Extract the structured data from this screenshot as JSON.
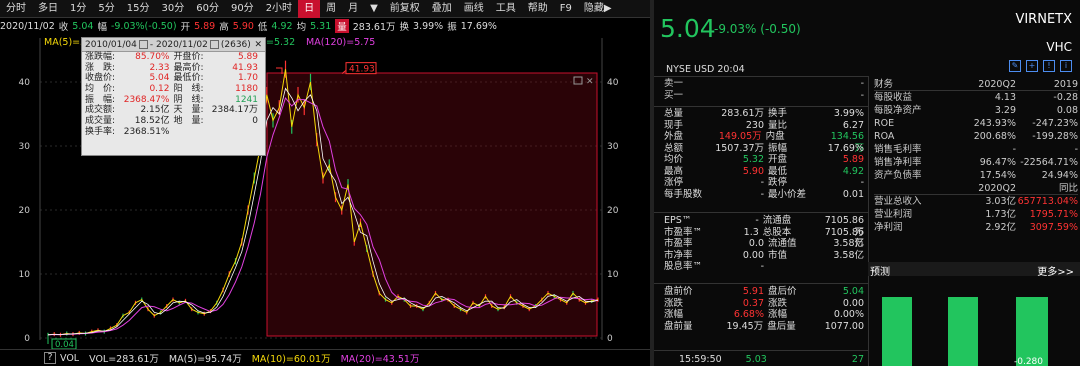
{
  "toolbar": {
    "items": [
      "分时",
      "多日",
      "1分",
      "5分",
      "15分",
      "30分",
      "60分",
      "90分",
      "2小时",
      "日",
      "周",
      "月",
      "▼",
      "前复权",
      "叠加",
      "画线",
      "工具",
      "帮助",
      "F9",
      "隐藏▶"
    ]
  },
  "quote": {
    "date": "2020/11/02",
    "close_label": "收",
    "close": "5.04",
    "chg_label": "幅",
    "chg": "-9.03%(-0.50)",
    "open_label": "开",
    "open": "5.89",
    "high_label": "高",
    "high": "5.90",
    "low_label": "低",
    "low": "4.92",
    "settle_label": "均",
    "settle": "5.31",
    "vol_label": "量",
    "vol": "283.61万",
    "turn_label": "换",
    "turn": "3.99%",
    "amp_label": "振",
    "amp": "17.69%"
  },
  "ma": {
    "ma5": "MA(5)=5",
    "ma120": "MA(120)=5.75",
    "ma60": "=5.32"
  },
  "tooltip": {
    "header": "2010/01/04",
    "header2": "- 2020/11/02",
    "count": "(2636)",
    "rows": [
      [
        "涨跌幅:",
        "85.70%",
        "开盘价:",
        "5.89"
      ],
      [
        "涨　跌:",
        "2.33",
        "最高价:",
        "41.93"
      ],
      [
        "收盘价:",
        "5.04",
        "最低价:",
        "1.70"
      ],
      [
        "均　价:",
        "0.12",
        "阳　线:",
        "1180"
      ],
      [
        "振　幅:",
        "2368.47%",
        "阴　线:",
        "1241"
      ],
      [
        "成交额:",
        "2.15亿",
        "天　量:",
        "2384.17万"
      ],
      [
        "成交量:",
        "18.52亿",
        "地　量:",
        "0"
      ],
      [
        "换手率:",
        "2368.51%",
        "",
        ""
      ]
    ]
  },
  "chart_data": {
    "type": "line",
    "title": "",
    "y_ticks": [
      0,
      10,
      20,
      30,
      40
    ],
    "ylim": [
      0,
      45
    ],
    "annotations": {
      "max": "41.93",
      "min": "0.04"
    },
    "series": [
      {
        "values": [
          0.5,
          0.6,
          0.5,
          0.7,
          0.6,
          0.8,
          0.7,
          1.0,
          1.2,
          1.0,
          1.5,
          2.0,
          3.5,
          4.0,
          5.5,
          6.0,
          4.5,
          3.5,
          4.0,
          5.0,
          6.0,
          5.5,
          5.8,
          4.5,
          4.0,
          3.8,
          4.2,
          5.5,
          7.5,
          10.0,
          12.0,
          15.0,
          20.0,
          25.0,
          30.0,
          38.0,
          34.0,
          36.0,
          42.0,
          33.0,
          38.0,
          36.0,
          40.0,
          31.0,
          25.0,
          27.0,
          22.0,
          20.0,
          24.0,
          15.0,
          18.0,
          14.0,
          10.0,
          7.0,
          6.0,
          5.5,
          6.5,
          6.0,
          5.0,
          5.0,
          4.5,
          5.5,
          7.0,
          6.0,
          6.0,
          5.0,
          4.5,
          4.0,
          5.5,
          5.0,
          6.5,
          5.0,
          4.5,
          4.8,
          6.5,
          5.5,
          5.0,
          4.5,
          5.0,
          6.0,
          7.0,
          6.5,
          6.0,
          5.5,
          7.0,
          6.0,
          5.5,
          5.8,
          6.0
        ]
      }
    ]
  },
  "vol": {
    "label": "VOL",
    "vol": "VOL=283.61万",
    "ma5": "MA(5)=95.74万",
    "ma10": "MA(10)=60.01万",
    "ma20": "MA(20)=43.51万"
  },
  "right": {
    "price": "5.04",
    "change": "-9.03%",
    "change2": "(-0.50)",
    "ticker": "VIRNETX",
    "sub": "VHC",
    "exchange": "NYSE",
    "currency": "USD",
    "time": "20:04",
    "sell1": "卖一",
    "buy1": "买一",
    "dash": "-",
    "left_rows": [
      [
        "总量",
        "283.61万",
        "换手",
        "3.99%"
      ],
      [
        "现手",
        "230",
        "量比",
        "6.27"
      ],
      [
        "外盘",
        "149.05万",
        "内盘",
        "134.56万"
      ],
      [
        "总额",
        "1507.37万",
        "振幅",
        "17.69%"
      ],
      [
        "均价",
        "5.32",
        "开盘",
        "5.89"
      ],
      [
        "最高",
        "5.90",
        "最低",
        "4.92"
      ],
      [
        "涨停",
        "-",
        "跌停",
        "-"
      ],
      [
        "每手股数",
        "-",
        "最小价差",
        "0.01"
      ]
    ],
    "left_rows2": [
      [
        "EPS™",
        "-",
        "流通盘",
        "7105.86万"
      ],
      [
        "市盈率™",
        "1.3",
        "总股本",
        "7105.86万"
      ],
      [
        "市盈率",
        "0.0",
        "流通值",
        "3.58亿"
      ],
      [
        "市净率",
        "0.00",
        "市值",
        "3.58亿"
      ],
      [
        "股息率™",
        "-",
        "",
        ""
      ]
    ],
    "left_rows3": [
      [
        "盘前价",
        "5.91",
        "盘后价",
        "5.04"
      ],
      [
        "涨跌",
        "0.37",
        "涨跌",
        "0.00"
      ],
      [
        "涨幅",
        "6.68%",
        "涨幅",
        "0.00%"
      ],
      [
        "盘前量",
        "19.45万",
        "盘后量",
        "1077.00"
      ]
    ],
    "tick": [
      "15:59:50",
      "5.03",
      "27"
    ],
    "fin_head": [
      "财务",
      "2020Q2",
      "2019"
    ],
    "fin_rows": [
      [
        "每股收益",
        "4.13",
        "-0.28"
      ],
      [
        "每股净资产",
        "3.29",
        "0.08"
      ],
      [
        "ROE",
        "243.93%",
        "-247.23%"
      ],
      [
        "ROA",
        "200.68%",
        "-199.28%"
      ],
      [
        "销售毛利率",
        "-",
        "-"
      ],
      [
        "销售净利率",
        "96.47%",
        "-22564.71%"
      ],
      [
        "资产负债率",
        "17.54%",
        "24.94%"
      ]
    ],
    "fin_head2": [
      "",
      "2020Q2",
      "同比"
    ],
    "fin_rows2": [
      [
        "营业总收入",
        "3.03亿",
        "657713.04%"
      ],
      [
        "营业利润",
        "1.73亿",
        "1795.71%"
      ],
      [
        "净利润",
        "2.92亿",
        "3097.59%"
      ]
    ],
    "forecast": "预测",
    "more": "更多>>",
    "bars": [
      "-0.280"
    ]
  },
  "colors": {
    "up": "#ff3333",
    "down": "#22c55e",
    "ma5": "#ffffff",
    "ma10": "#f5d90a",
    "ma20": "#e040e0",
    "select": "#c8102e"
  }
}
